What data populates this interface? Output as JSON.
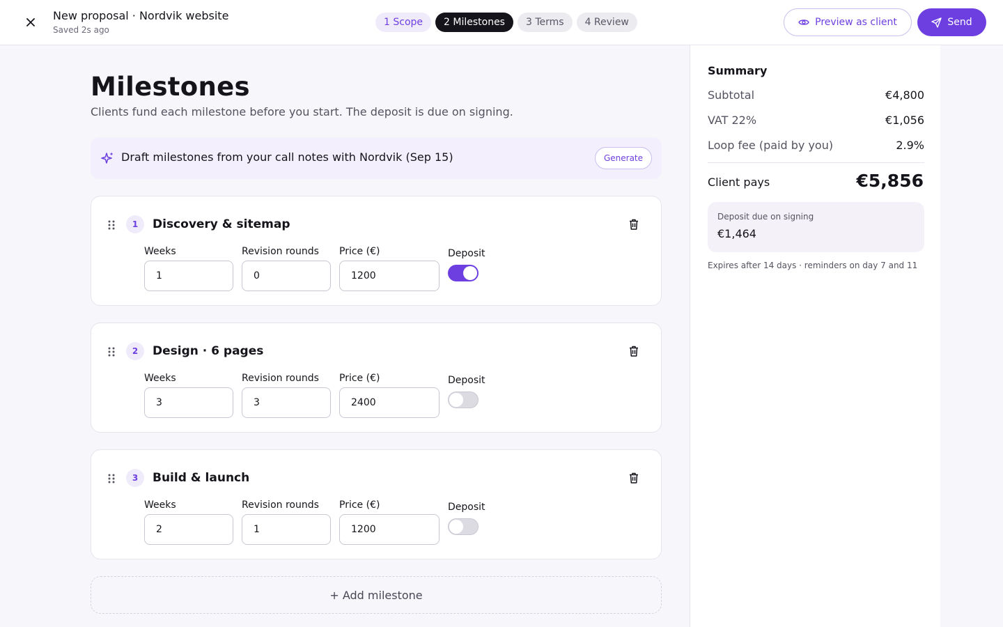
{
  "header": {
    "title": "New proposal · Nordvik website",
    "status": "Saved 2s ago",
    "steps": [
      {
        "label": "1 Scope"
      },
      {
        "label": "2 Milestones"
      },
      {
        "label": "3 Terms"
      },
      {
        "label": "4 Review"
      }
    ],
    "preview_label": "Preview as client",
    "send_label": "Send"
  },
  "main": {
    "title": "Milestones",
    "subtitle": "Clients fund each milestone before you start. The deposit is due on signing.",
    "ai_banner": {
      "text": "Draft milestones from your call notes with Nordvik (Sep 15)",
      "button": "Generate"
    },
    "field_labels": {
      "weeks": "Weeks",
      "revisions": "Revision rounds",
      "price": "Price (€)",
      "deposit": "Deposit"
    },
    "milestones": [
      {
        "number": "1",
        "title": "Discovery & sitemap",
        "weeks": "1",
        "revisions": "0",
        "price": "1200",
        "deposit": true
      },
      {
        "number": "2",
        "title": "Design · 6 pages",
        "weeks": "3",
        "revisions": "3",
        "price": "2400",
        "deposit": false
      },
      {
        "number": "3",
        "title": "Build & launch",
        "weeks": "2",
        "revisions": "1",
        "price": "1200",
        "deposit": false
      }
    ],
    "add_label": "+ Add milestone"
  },
  "summary": {
    "title": "Summary",
    "rows": [
      {
        "label": "Subtotal",
        "value": "€4,800"
      },
      {
        "label": "VAT 22%",
        "value": "€1,056"
      },
      {
        "label": "Loop fee (paid by you)",
        "value": "2.9%"
      }
    ],
    "total_label": "Client pays",
    "total_value": "€5,856",
    "deposit_label": "Deposit due on signing",
    "deposit_value": "€1,464",
    "note": "Expires after 14 days · reminders on day 7 and 11"
  },
  "colors": {
    "accent": "#6d3fe0",
    "accent_light": "#f0ebfb",
    "dark": "#15141a"
  }
}
